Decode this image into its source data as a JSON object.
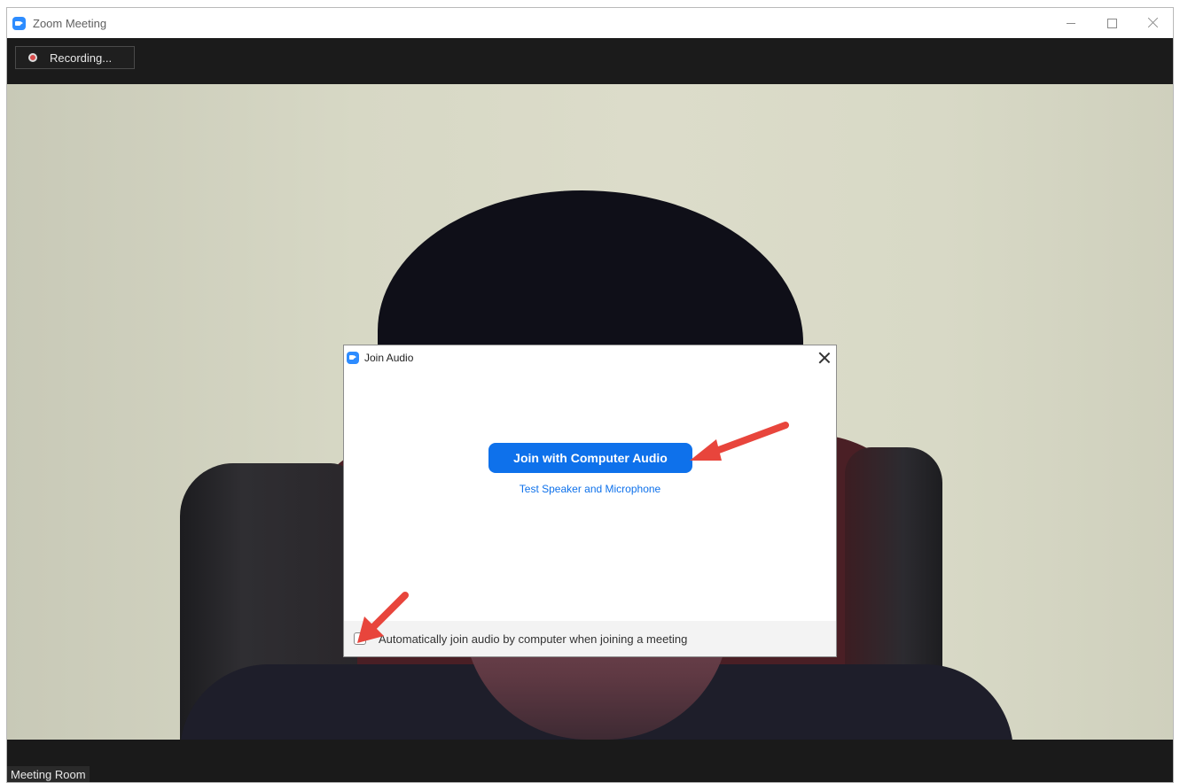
{
  "window": {
    "title": "Zoom Meeting",
    "controls": {
      "minimize": "minimize",
      "maximize": "maximize",
      "close": "close"
    }
  },
  "topbar": {
    "recording_label": "Recording..."
  },
  "footer": {
    "meeting_label": "Meeting Room"
  },
  "dialog": {
    "title": "Join Audio",
    "join_button_label": "Join with Computer Audio",
    "test_link_label": "Test Speaker and Microphone",
    "auto_join_label": "Automatically join audio by computer when joining a meeting",
    "auto_join_checked": false
  },
  "colors": {
    "accent": "#0e71eb",
    "zoom_blue": "#2d8cff",
    "annotation_arrow": "#e8453c",
    "recording_dot": "#d94b4b"
  },
  "icons": {
    "app": "zoom-camera-icon",
    "recording": "record-dot-icon",
    "dialog": "zoom-camera-icon",
    "dialog_close": "close-icon",
    "annotation": "red-arrow-icon"
  }
}
